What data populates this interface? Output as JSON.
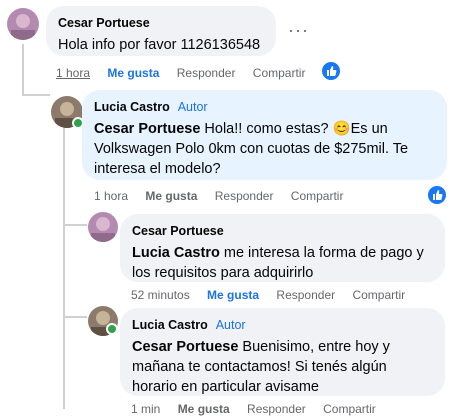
{
  "comments": [
    {
      "author": "Cesar Portuese",
      "badge": "",
      "text": "Hola info por favor 1126136548",
      "time": "1 hora",
      "like": "Me gusta",
      "reply": "Responder",
      "share": "Compartir"
    },
    {
      "author": "Lucia Castro",
      "badge": "Autor",
      "mention": "Cesar Portuese",
      "text": " Hola!! como estas? 😊Es un Volkswagen Polo 0km con cuotas de $275mil. Te interesa el modelo?",
      "time": "1 hora",
      "like": "Me gusta",
      "reply": "Responder",
      "share": "Compartir"
    },
    {
      "author": "Cesar Portuese",
      "badge": "",
      "mention": "Lucia Castro",
      "text": " me interesa la forma de pago y los requisitos para adquirirlo",
      "time": "52 minutos",
      "like": "Me gusta",
      "reply": "Responder",
      "share": "Compartir"
    },
    {
      "author": "Lucia Castro",
      "badge": "Autor",
      "mention": "Cesar Portuese",
      "text": " Buenisimo, entre hoy y mañana te contactamos! Si tenés algún horario en particular avisame",
      "time": "1 min",
      "like": "Me gusta",
      "reply": "Responder",
      "share": "Compartir"
    }
  ],
  "more_label": "···",
  "colors": {
    "accent": "#1b74e4",
    "bubble_grey": "#f0f2f5",
    "bubble_blue": "#e7f3ff",
    "online": "#31a24c"
  }
}
